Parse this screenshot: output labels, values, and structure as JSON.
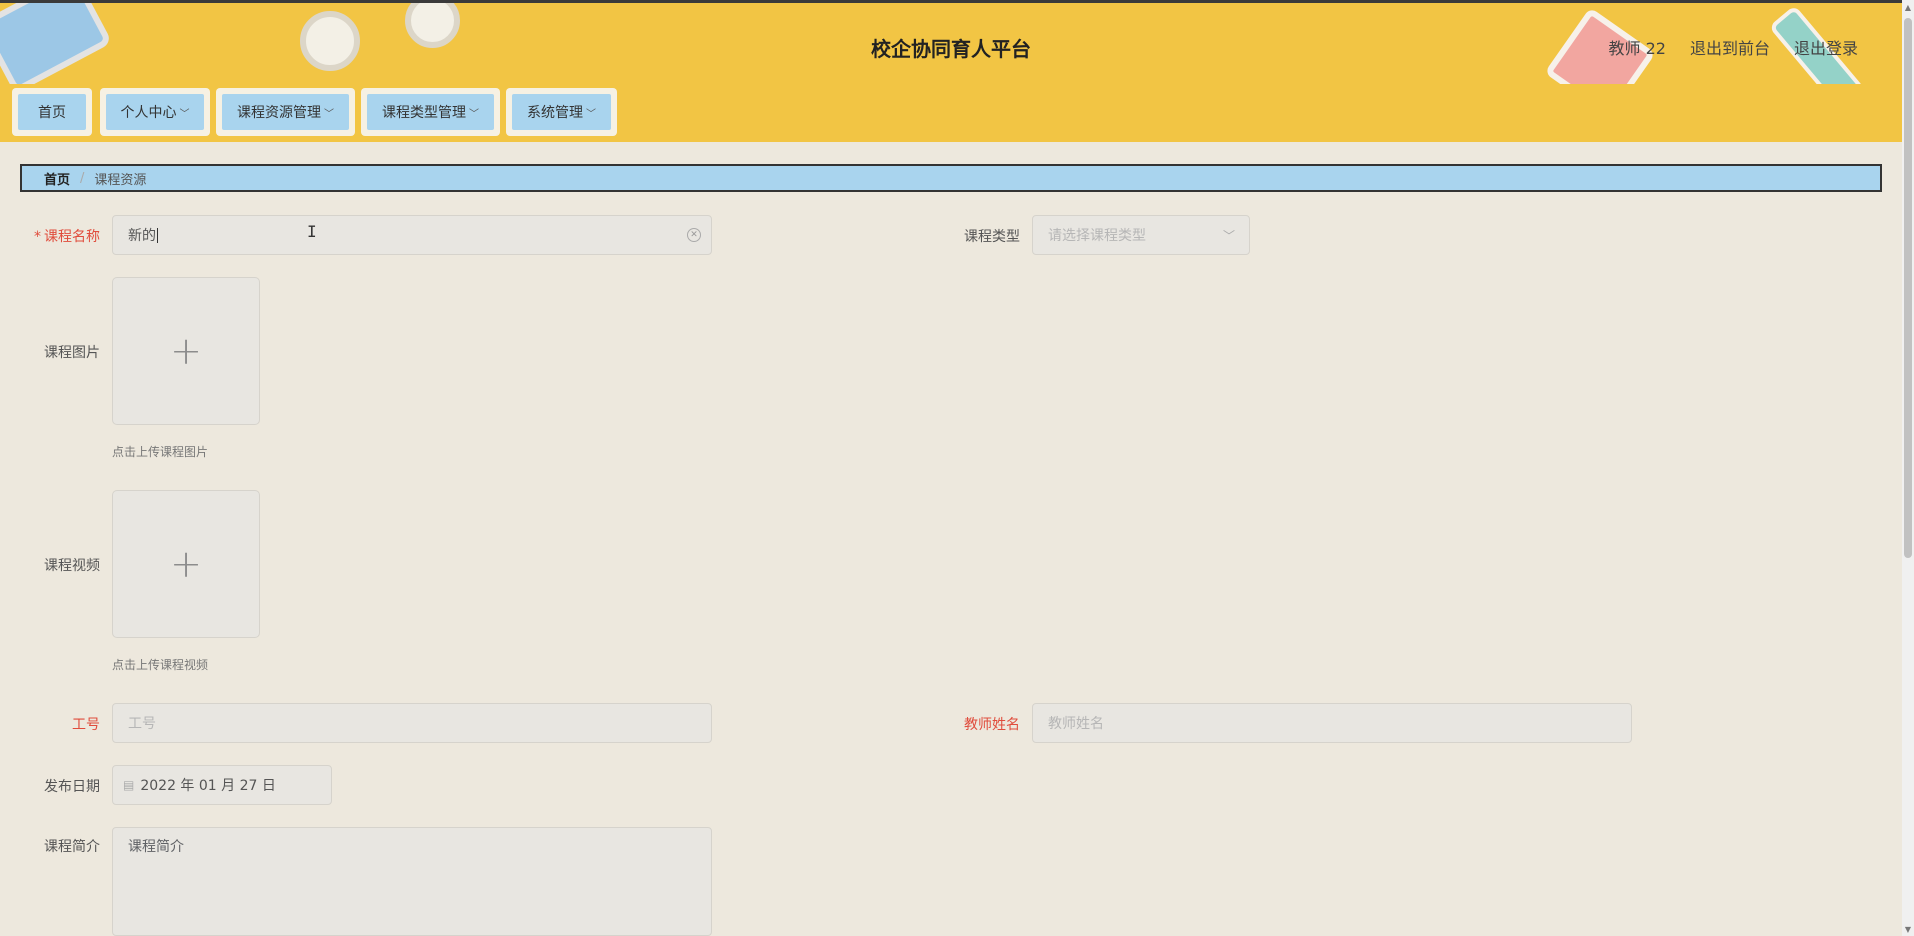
{
  "header": {
    "title": "校企协同育人平台",
    "user": "教师 22",
    "to_front": "退出到前台",
    "logout": "退出登录"
  },
  "nav": {
    "items": [
      {
        "label": "首页",
        "has_dropdown": false
      },
      {
        "label": "个人中心",
        "has_dropdown": true
      },
      {
        "label": "课程资源管理",
        "has_dropdown": true
      },
      {
        "label": "课程类型管理",
        "has_dropdown": true
      },
      {
        "label": "系统管理",
        "has_dropdown": true
      }
    ]
  },
  "breadcrumb": {
    "home": "首页",
    "separator": "/",
    "current": "课程资源"
  },
  "form": {
    "course_name": {
      "label": "课程名称",
      "value": "新的",
      "required": true
    },
    "course_type": {
      "label": "课程类型",
      "placeholder": "请选择课程类型"
    },
    "course_image": {
      "label": "课程图片",
      "hint": "点击上传课程图片"
    },
    "course_video": {
      "label": "课程视频",
      "hint": "点击上传课程视频"
    },
    "job_no": {
      "label": "工号",
      "placeholder": "工号"
    },
    "teacher_name": {
      "label": "教师姓名",
      "placeholder": "教师姓名"
    },
    "publish_date": {
      "label": "发布日期",
      "value": "2022 年 01 月 27 日"
    },
    "intro": {
      "label": "课程简介",
      "placeholder": "课程简介"
    }
  },
  "colors": {
    "header_bg": "#f2c544",
    "nav_button": "#a9d4ee",
    "page_bg": "#ede8dd",
    "required": "#e04c3c"
  }
}
